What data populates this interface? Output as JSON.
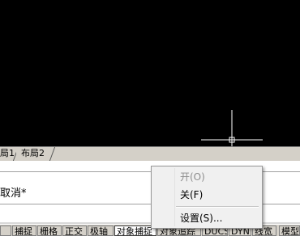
{
  "tabs": [
    {
      "label": "局1"
    },
    {
      "label": "布局2"
    }
  ],
  "command_line": {
    "text": "取消*"
  },
  "status_bar": {
    "buttons": [
      {
        "label": "捕捉",
        "active": false
      },
      {
        "label": "栅格",
        "active": false
      },
      {
        "label": "正交",
        "active": false
      },
      {
        "label": "极轴",
        "active": false
      },
      {
        "label": "对象捕捉",
        "active": true
      },
      {
        "label": "对象追踪",
        "active": false
      },
      {
        "label": "DUCS",
        "active": false
      },
      {
        "label": "DYN",
        "active": false
      },
      {
        "label": "线宽",
        "active": false
      },
      {
        "label": "模型",
        "active": false
      }
    ]
  },
  "context_menu": {
    "items": [
      {
        "label": "开(O)",
        "enabled": false
      },
      {
        "label": "关(F)",
        "enabled": true
      },
      {
        "label": "设置(S)...",
        "enabled": true
      }
    ]
  },
  "colors": {
    "canvas_background": "#000000",
    "crosshair": "#ffffff"
  }
}
